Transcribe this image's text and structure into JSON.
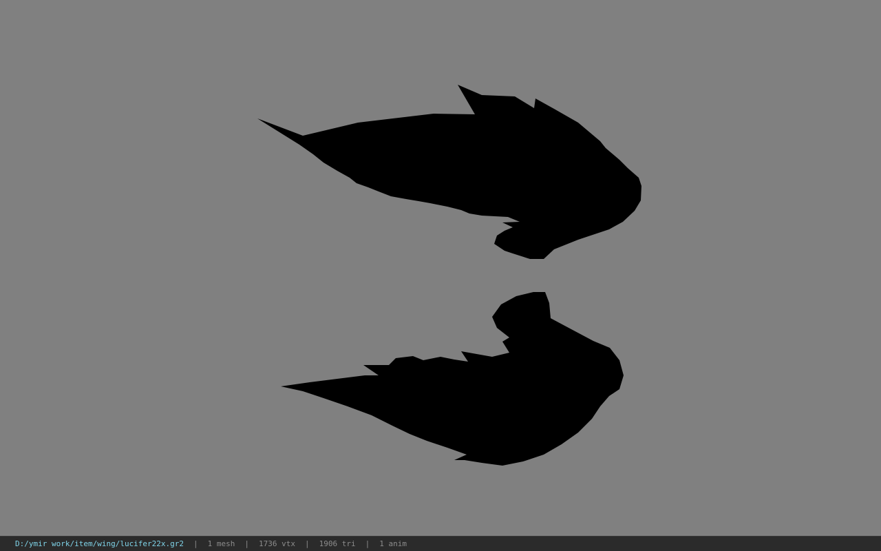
{
  "viewport": {
    "background": "#808080",
    "silhouette_color": "#000000",
    "model": "wing-pair"
  },
  "status": {
    "file_path": "D:/ymir work/item/wing/lucifer22x.gr2",
    "meshes": "1 mesh",
    "vertices": "1736 vtx",
    "triangles": "1906 tri",
    "animations": "1 anim",
    "separator": "|",
    "path_color": "#7fd3e8",
    "text_color": "#8c8c8c",
    "bar_color": "#2b2b2b"
  }
}
